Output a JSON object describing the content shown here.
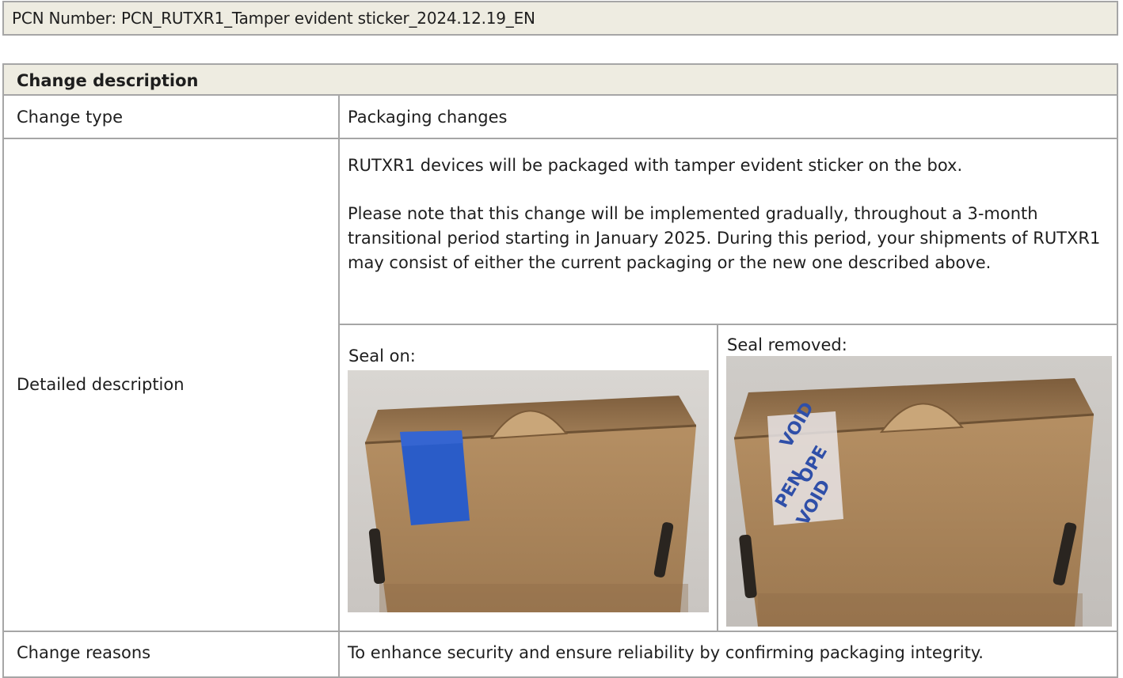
{
  "header": {
    "pcn_number": "PCN Number: PCN_RUTXR1_Tamper evident sticker_2024.12.19_EN"
  },
  "table": {
    "title": "Change description",
    "change_type_label": "Change type",
    "change_type_value": "Packaging changes",
    "detailed_label": "Detailed description",
    "detailed_paragraphs": [
      "RUTXR1 devices will be packaged with tamper evident sticker on the box.",
      "Please note that this change will be implemented gradually, throughout a 3-month transitional period starting in January 2025. During this period, your shipments of RUTXR1 may consist of either the current packaging or the new one described above."
    ],
    "seal_on_caption": "Seal on:",
    "seal_removed_caption": "Seal removed:",
    "change_reasons_label": "Change reasons",
    "change_reasons_value": "To enhance security and ensure reliability by confirming packaging integrity."
  },
  "photos": {
    "seal_on": {
      "subject": "cardboard box with blue tamper evident sticker intact",
      "sticker_color": "#2a5cc8",
      "box_color": "#b08a5c"
    },
    "seal_removed": {
      "subject": "cardboard box with tamper sticker removed showing VOID OPENED residue",
      "residue_text": "VOID OPENED",
      "box_color": "#b08a5c"
    }
  }
}
